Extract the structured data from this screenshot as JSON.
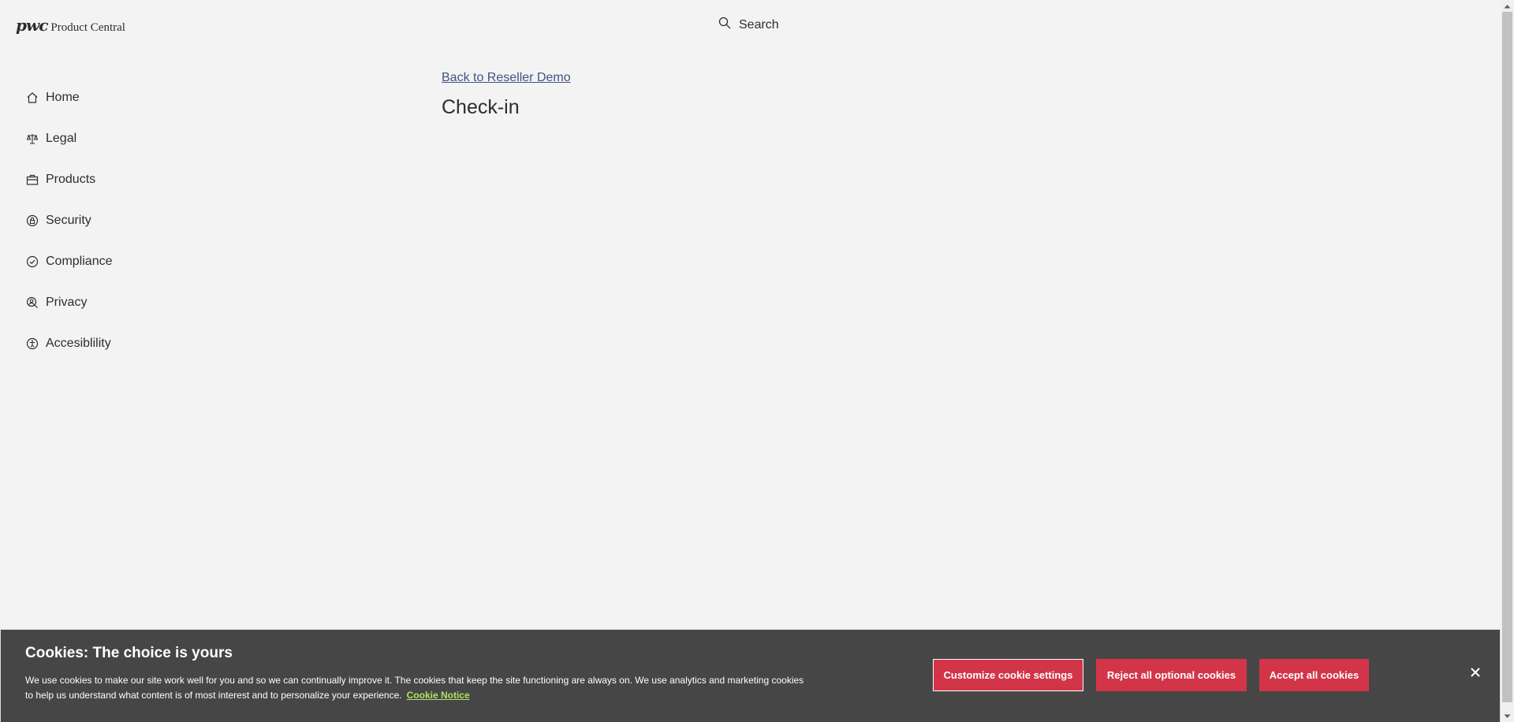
{
  "header": {
    "logo_mark": "pwc",
    "logo_text": "Product Central",
    "search_label": "Search"
  },
  "sidebar": {
    "items": [
      {
        "label": "Home",
        "icon": "home-icon"
      },
      {
        "label": "Legal",
        "icon": "scales-icon"
      },
      {
        "label": "Products",
        "icon": "briefcase-icon"
      },
      {
        "label": "Security",
        "icon": "shield-lock-icon"
      },
      {
        "label": "Compliance",
        "icon": "check-circle-icon"
      },
      {
        "label": "Privacy",
        "icon": "user-search-icon"
      },
      {
        "label": "Accesiblility",
        "icon": "accessibility-icon"
      }
    ]
  },
  "main": {
    "back_link": "Back to Reseller Demo",
    "title": "Check-in"
  },
  "cookie_banner": {
    "title": "Cookies: The choice is yours",
    "text": "We use cookies to make our site work well for you and so we can continually improve it. The cookies that keep the site functioning are always on. We use analytics and marketing cookies to help us understand what content is of most interest and to personalize your experience.",
    "notice_link": "Cookie Notice",
    "customize_label": "Customize cookie settings",
    "reject_label": "Reject all optional cookies",
    "accept_label": "Accept all cookies"
  },
  "colors": {
    "background": "#f3f3f3",
    "link": "#415385",
    "banner_bg": "#464646",
    "button_red": "#d23548",
    "notice_link": "#b1e063"
  }
}
